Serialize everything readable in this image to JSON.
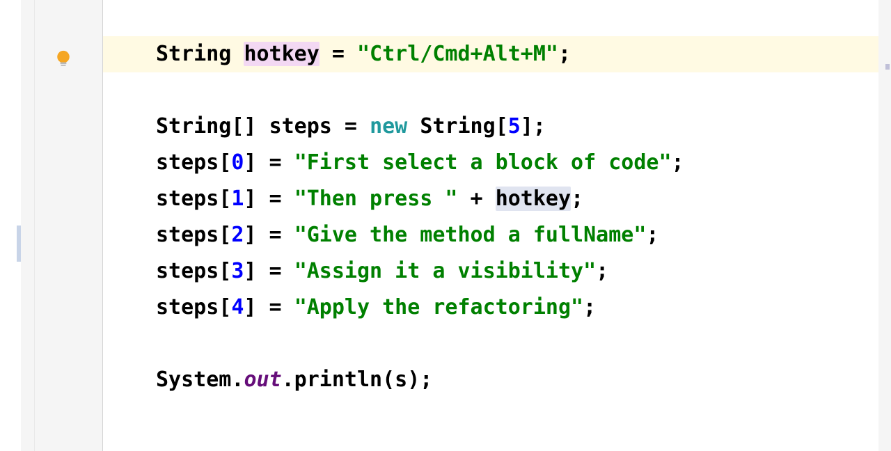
{
  "icons": {
    "intention_bulb": "intention-bulb-icon"
  },
  "code": {
    "type_string": "String",
    "var_hotkey": "hotkey",
    "assign_op": " = ",
    "hotkey_value": "\"Ctrl/Cmd+Alt+M\"",
    "semicolon": ";",
    "array_type": "String[]",
    "var_steps": "steps",
    "new_kw": "new",
    "array_ctor": "String[",
    "array_size": "5",
    "array_ctor_close": "]",
    "steps_prefix": "steps[",
    "idx0": "0",
    "idx1": "1",
    "idx2": "2",
    "idx3": "3",
    "idx4": "4",
    "steps_suffix": "] = ",
    "str0": "\"First select a block of code\"",
    "str1": "\"Then press \"",
    "concat": " + ",
    "str2": "\"Give the method a fullName\"",
    "str3": "\"Assign it a visibility\"",
    "str4": "\"Apply the refactoring\"",
    "sys": "System.",
    "out": "out",
    "println": ".println(s);"
  }
}
